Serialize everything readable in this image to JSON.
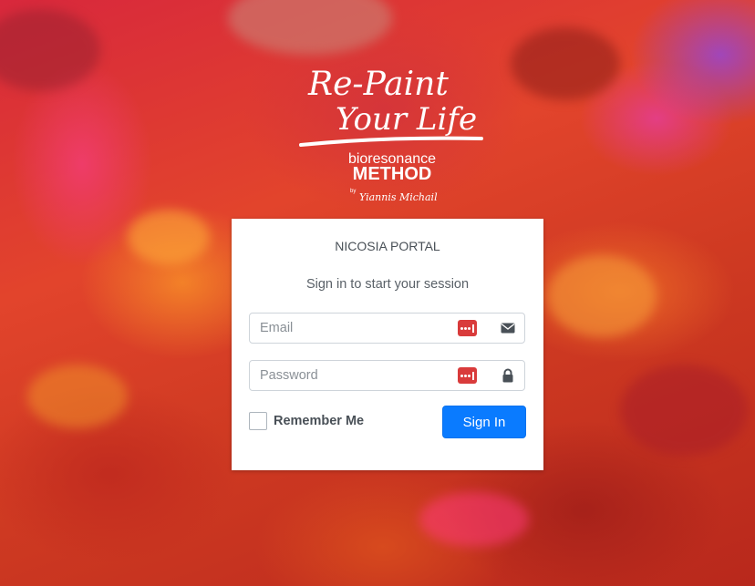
{
  "colors": {
    "primary_button": "#0a7bff",
    "password_manager_badge": "#d93b3b",
    "card_background": "#ffffff"
  },
  "logo": {
    "line1": "Re-Paint",
    "line2": "Your Life",
    "line3": "bioresonance",
    "line4": "METHOD",
    "byline": "by",
    "signature": "Yiannis Michail"
  },
  "login": {
    "portal_title": "NICOSIA PORTAL",
    "subtitle": "Sign in to start your session",
    "email_placeholder": "Email",
    "email_icon": "envelope-icon",
    "password_placeholder": "Password",
    "password_icon": "lock-icon",
    "password_manager_icon": "password-manager-icon",
    "remember_label": "Remember Me",
    "remember_checked": false,
    "signin_label": "Sign In"
  }
}
